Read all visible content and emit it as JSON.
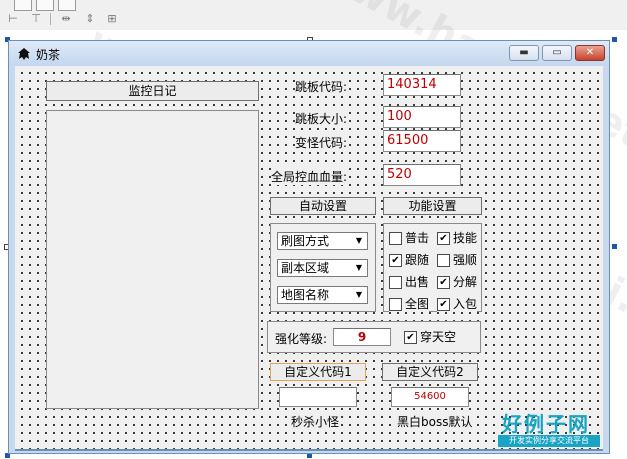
{
  "window": {
    "title": "奶茶"
  },
  "left_panel": {
    "log_button": "监控日记"
  },
  "fields": [
    {
      "label": "跳板代码:",
      "value": "140314"
    },
    {
      "label": "跳板大小:",
      "value": "100"
    },
    {
      "label": "变怪代码:",
      "value": "61500"
    },
    {
      "label": "全局控血血量:",
      "value": "520"
    }
  ],
  "buttons": {
    "auto_settings": "自动设置",
    "function_settings": "功能设置",
    "custom_code_1": "自定义代码1",
    "custom_code_2": "自定义代码2"
  },
  "combos": [
    {
      "value": "刷图方式"
    },
    {
      "value": "副本区域"
    },
    {
      "value": "地图名称"
    }
  ],
  "checkboxes": [
    {
      "label": "普击",
      "checked": false
    },
    {
      "label": "技能",
      "checked": true
    },
    {
      "label": "跟随",
      "checked": true
    },
    {
      "label": "强顺",
      "checked": false
    },
    {
      "label": "出售",
      "checked": false
    },
    {
      "label": "分解",
      "checked": true
    },
    {
      "label": "全图",
      "checked": false
    },
    {
      "label": "入包",
      "checked": true
    }
  ],
  "enhance": {
    "label": "强化等级:",
    "value": "9",
    "pierce_label": "穿天空",
    "pierce_checked": true
  },
  "custom": {
    "input1_value": "",
    "input2_value": "54600",
    "caption1": "秒杀小怪",
    "caption2": "黑白boss默认"
  },
  "watermark": {
    "text": "www.haolizi.net"
  },
  "logo": {
    "title": "好例子网",
    "subtitle": "开发实例分享交流平台"
  },
  "check_mark": "✔"
}
